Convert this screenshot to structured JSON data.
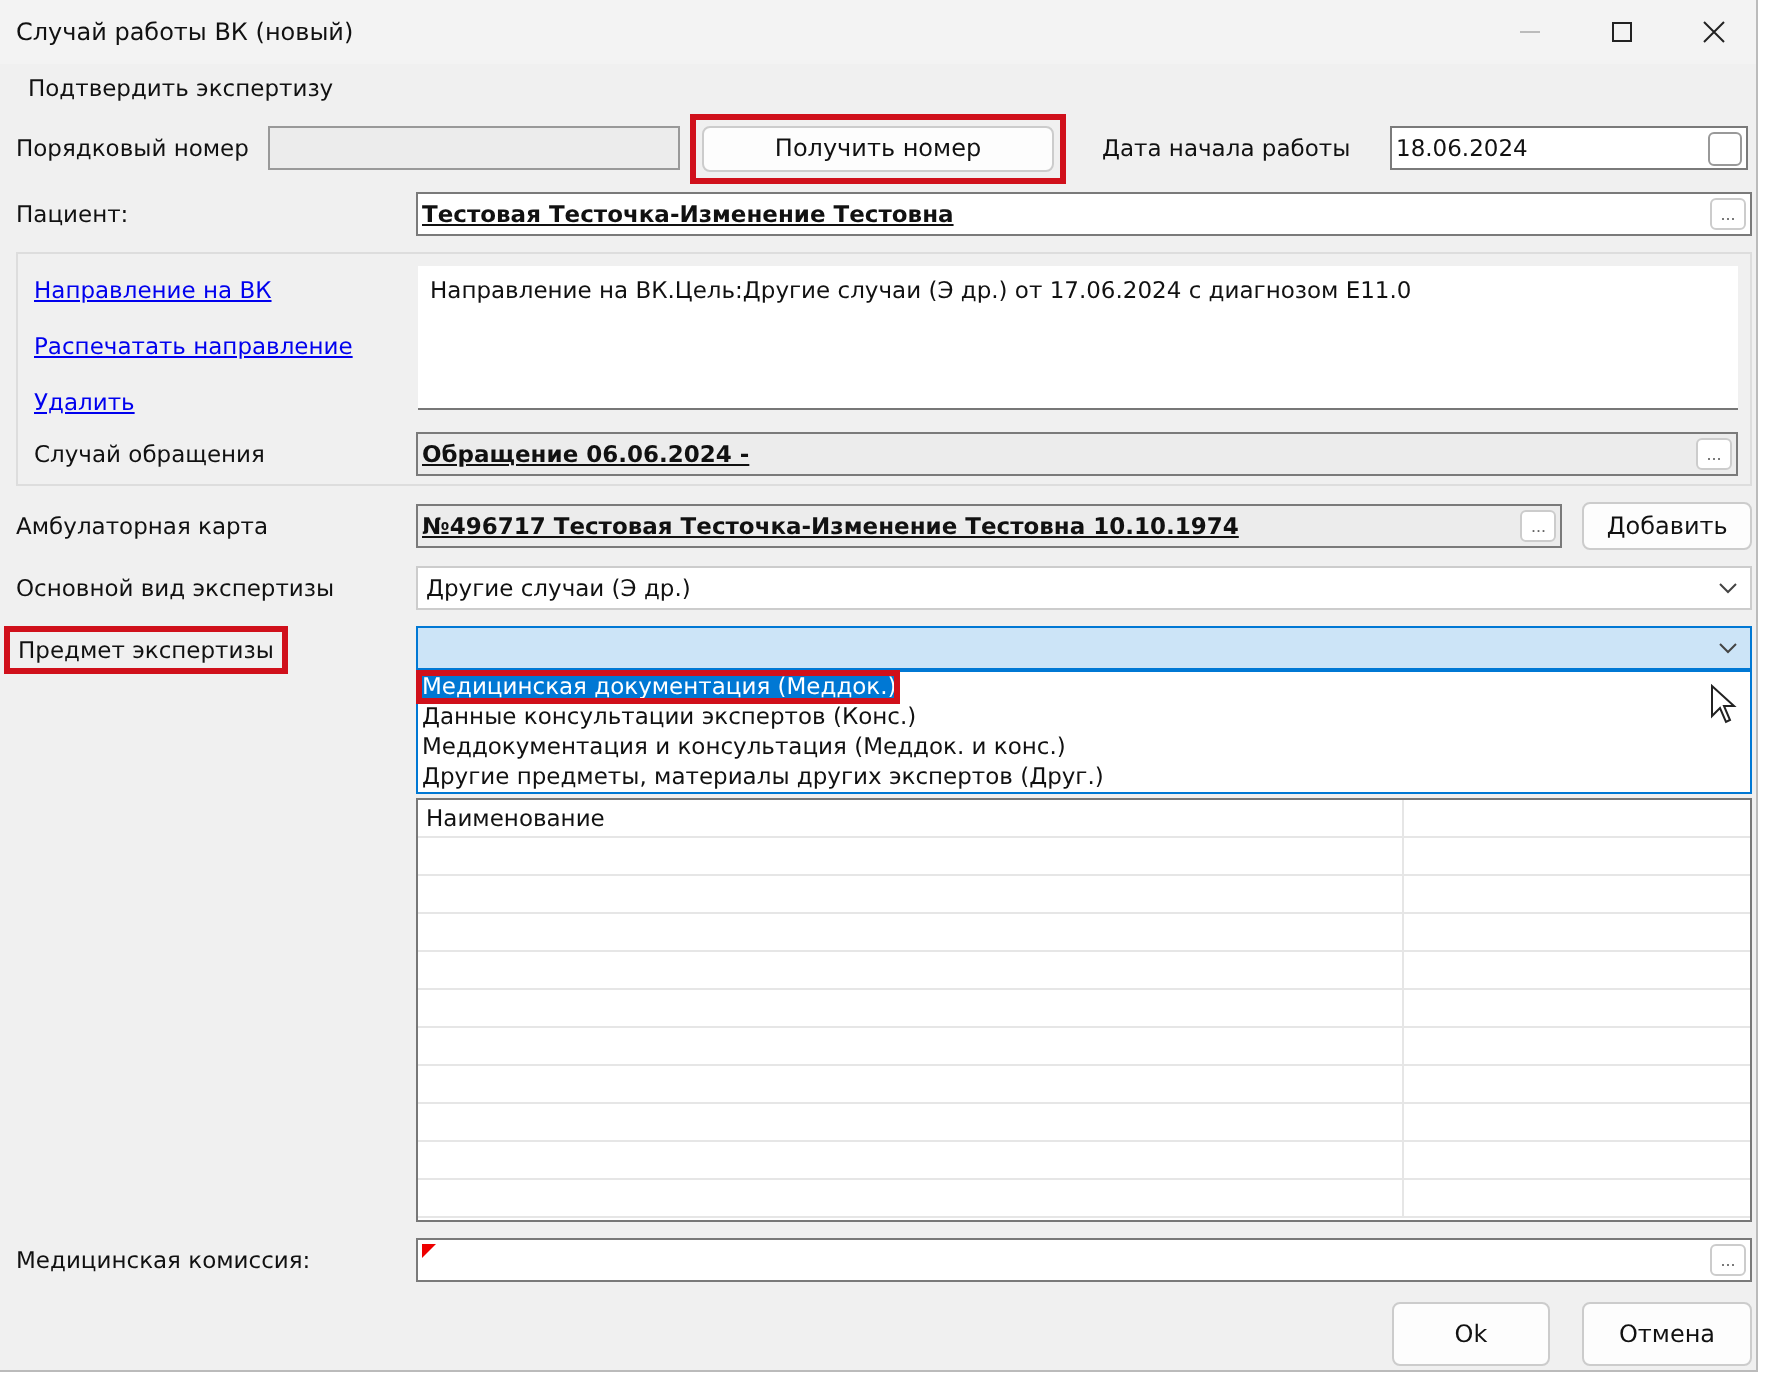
{
  "window": {
    "title": "Случай работы ВК (новый)"
  },
  "menu": [
    "Подтвердить экспертизу"
  ],
  "number": {
    "label": "Порядковый номер",
    "button": {
      "label": "Получить номер",
      "highlighted": true
    }
  },
  "start_date": {
    "label": "Дата начала работы",
    "value": "18.06.2024",
    "checked": false
  },
  "patient": {
    "label": "Пациент:",
    "value": "Тестовая Тесточка-Изменение Тестовна",
    "browse": "..."
  },
  "referral": {
    "links": [
      "Направление на ВК",
      "Распечатать направление",
      "Удалить"
    ],
    "text": "Направление на ВК.Цель:Другие случаи (Э др.) от 17.06.2024 с диагнозом E11.0",
    "case_label": "Случай обращения",
    "case_value": "Обращение 06.06.2024 -",
    "case_browse": "..."
  },
  "card": {
    "label": "Амбулаторная карта",
    "value": "№496717 Тестовая Тесточка-Изменение Тестовна 10.10.1974",
    "browse": "...",
    "button": "Добавить"
  },
  "exam_type": {
    "label": "Основной вид экспертизы",
    "value": "Другие случаи (Э др.)"
  },
  "exam_subject": {
    "label": "Предмет экспертизы",
    "highlighted": true,
    "expanded": true,
    "options": [
      {
        "label": "Медицинская документация (Меддок.)",
        "selected": true,
        "highlighted": true
      },
      {
        "label": "Данные консультации экспертов (Конс.)",
        "selected": false,
        "highlighted": false
      },
      {
        "label": "Меддокументация и консультация (Меддок. и конс.)",
        "selected": false,
        "highlighted": false
      },
      {
        "label": "Другие предметы, материалы других экспертов (Друг.)",
        "selected": false,
        "highlighted": false
      }
    ]
  },
  "table": {
    "columns": [
      "Наименование"
    ]
  },
  "commission": {
    "label": "Медицинская комиссия:",
    "required": true,
    "browse": "..."
  },
  "buttons": [
    "Ok",
    "Отмена"
  ]
}
